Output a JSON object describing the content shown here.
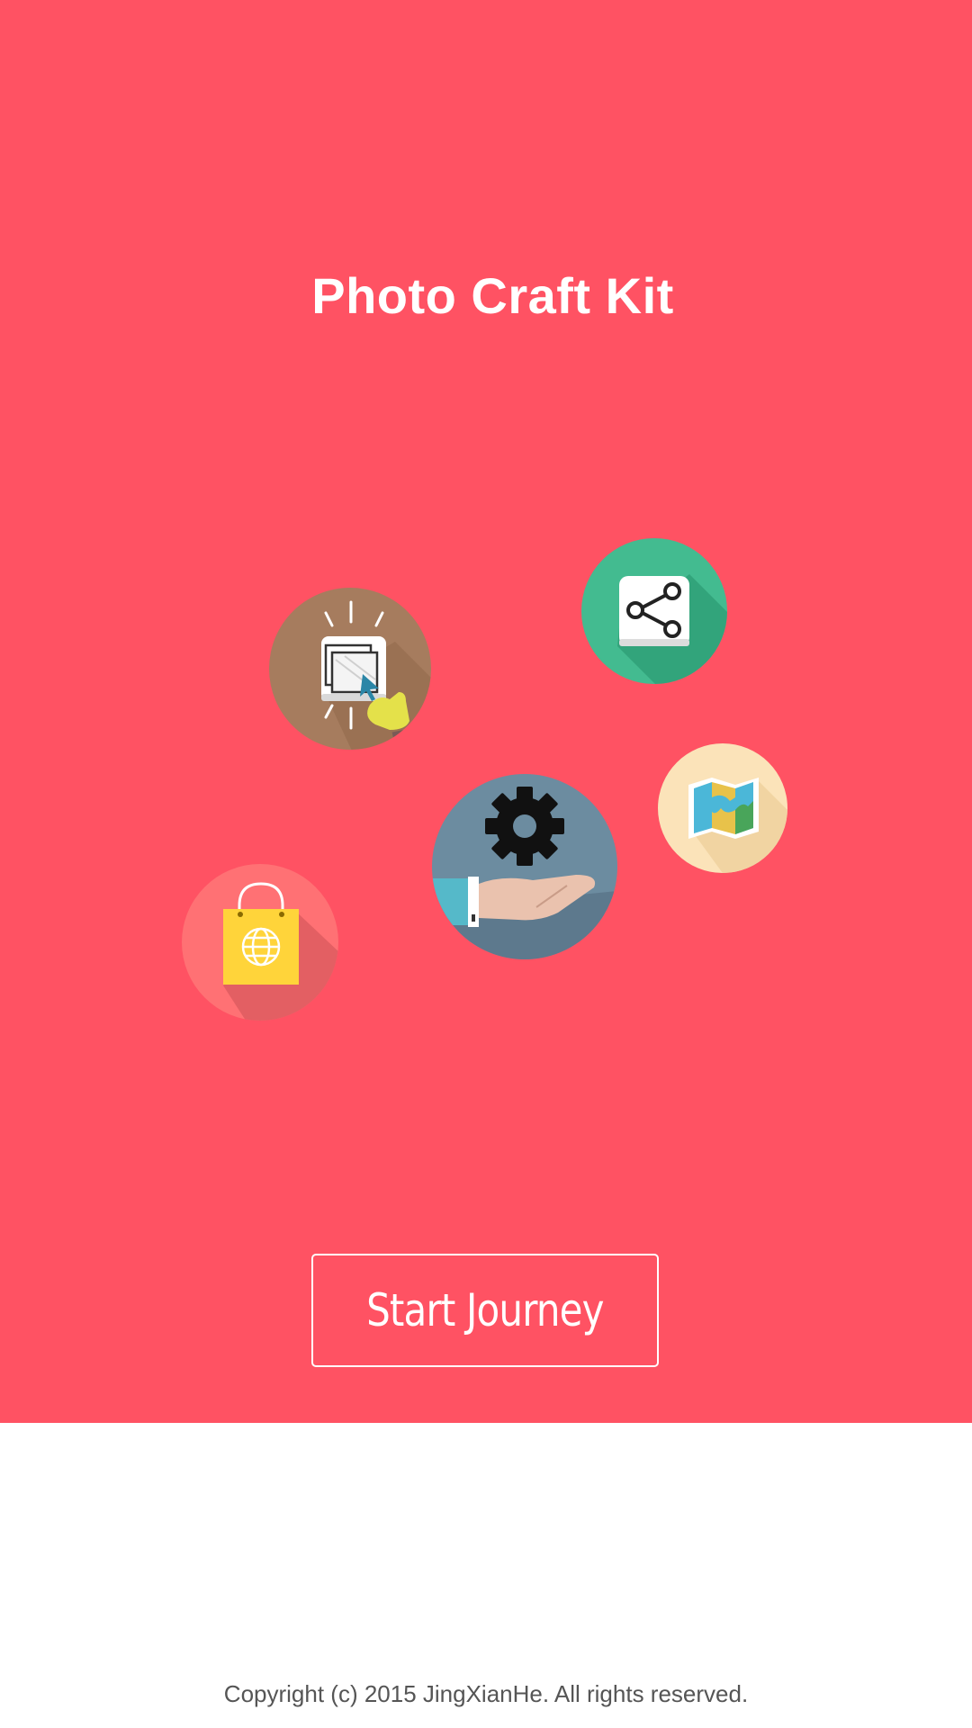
{
  "app": {
    "title": "Photo Craft Kit"
  },
  "feature_icons": [
    {
      "name": "folder-select-icon",
      "color": "#A67C5E"
    },
    {
      "name": "share-icon",
      "color": "#43BB90"
    },
    {
      "name": "map-icon",
      "color": "#FBE3B9"
    },
    {
      "name": "gear-in-hand-icon",
      "color": "#6C8CA0"
    },
    {
      "name": "shopping-bag-globe-icon",
      "color": "#FF7174"
    }
  ],
  "actions": {
    "start_label": "Start Journey"
  },
  "footer": {
    "copyright": "Copyright (c) 2015 JingXianHe. All rights reserved."
  },
  "colors": {
    "hero_background": "#FF5263",
    "page_background": "#FFFFFF",
    "text_light": "#FFFFFF",
    "footer_text": "#555555"
  }
}
